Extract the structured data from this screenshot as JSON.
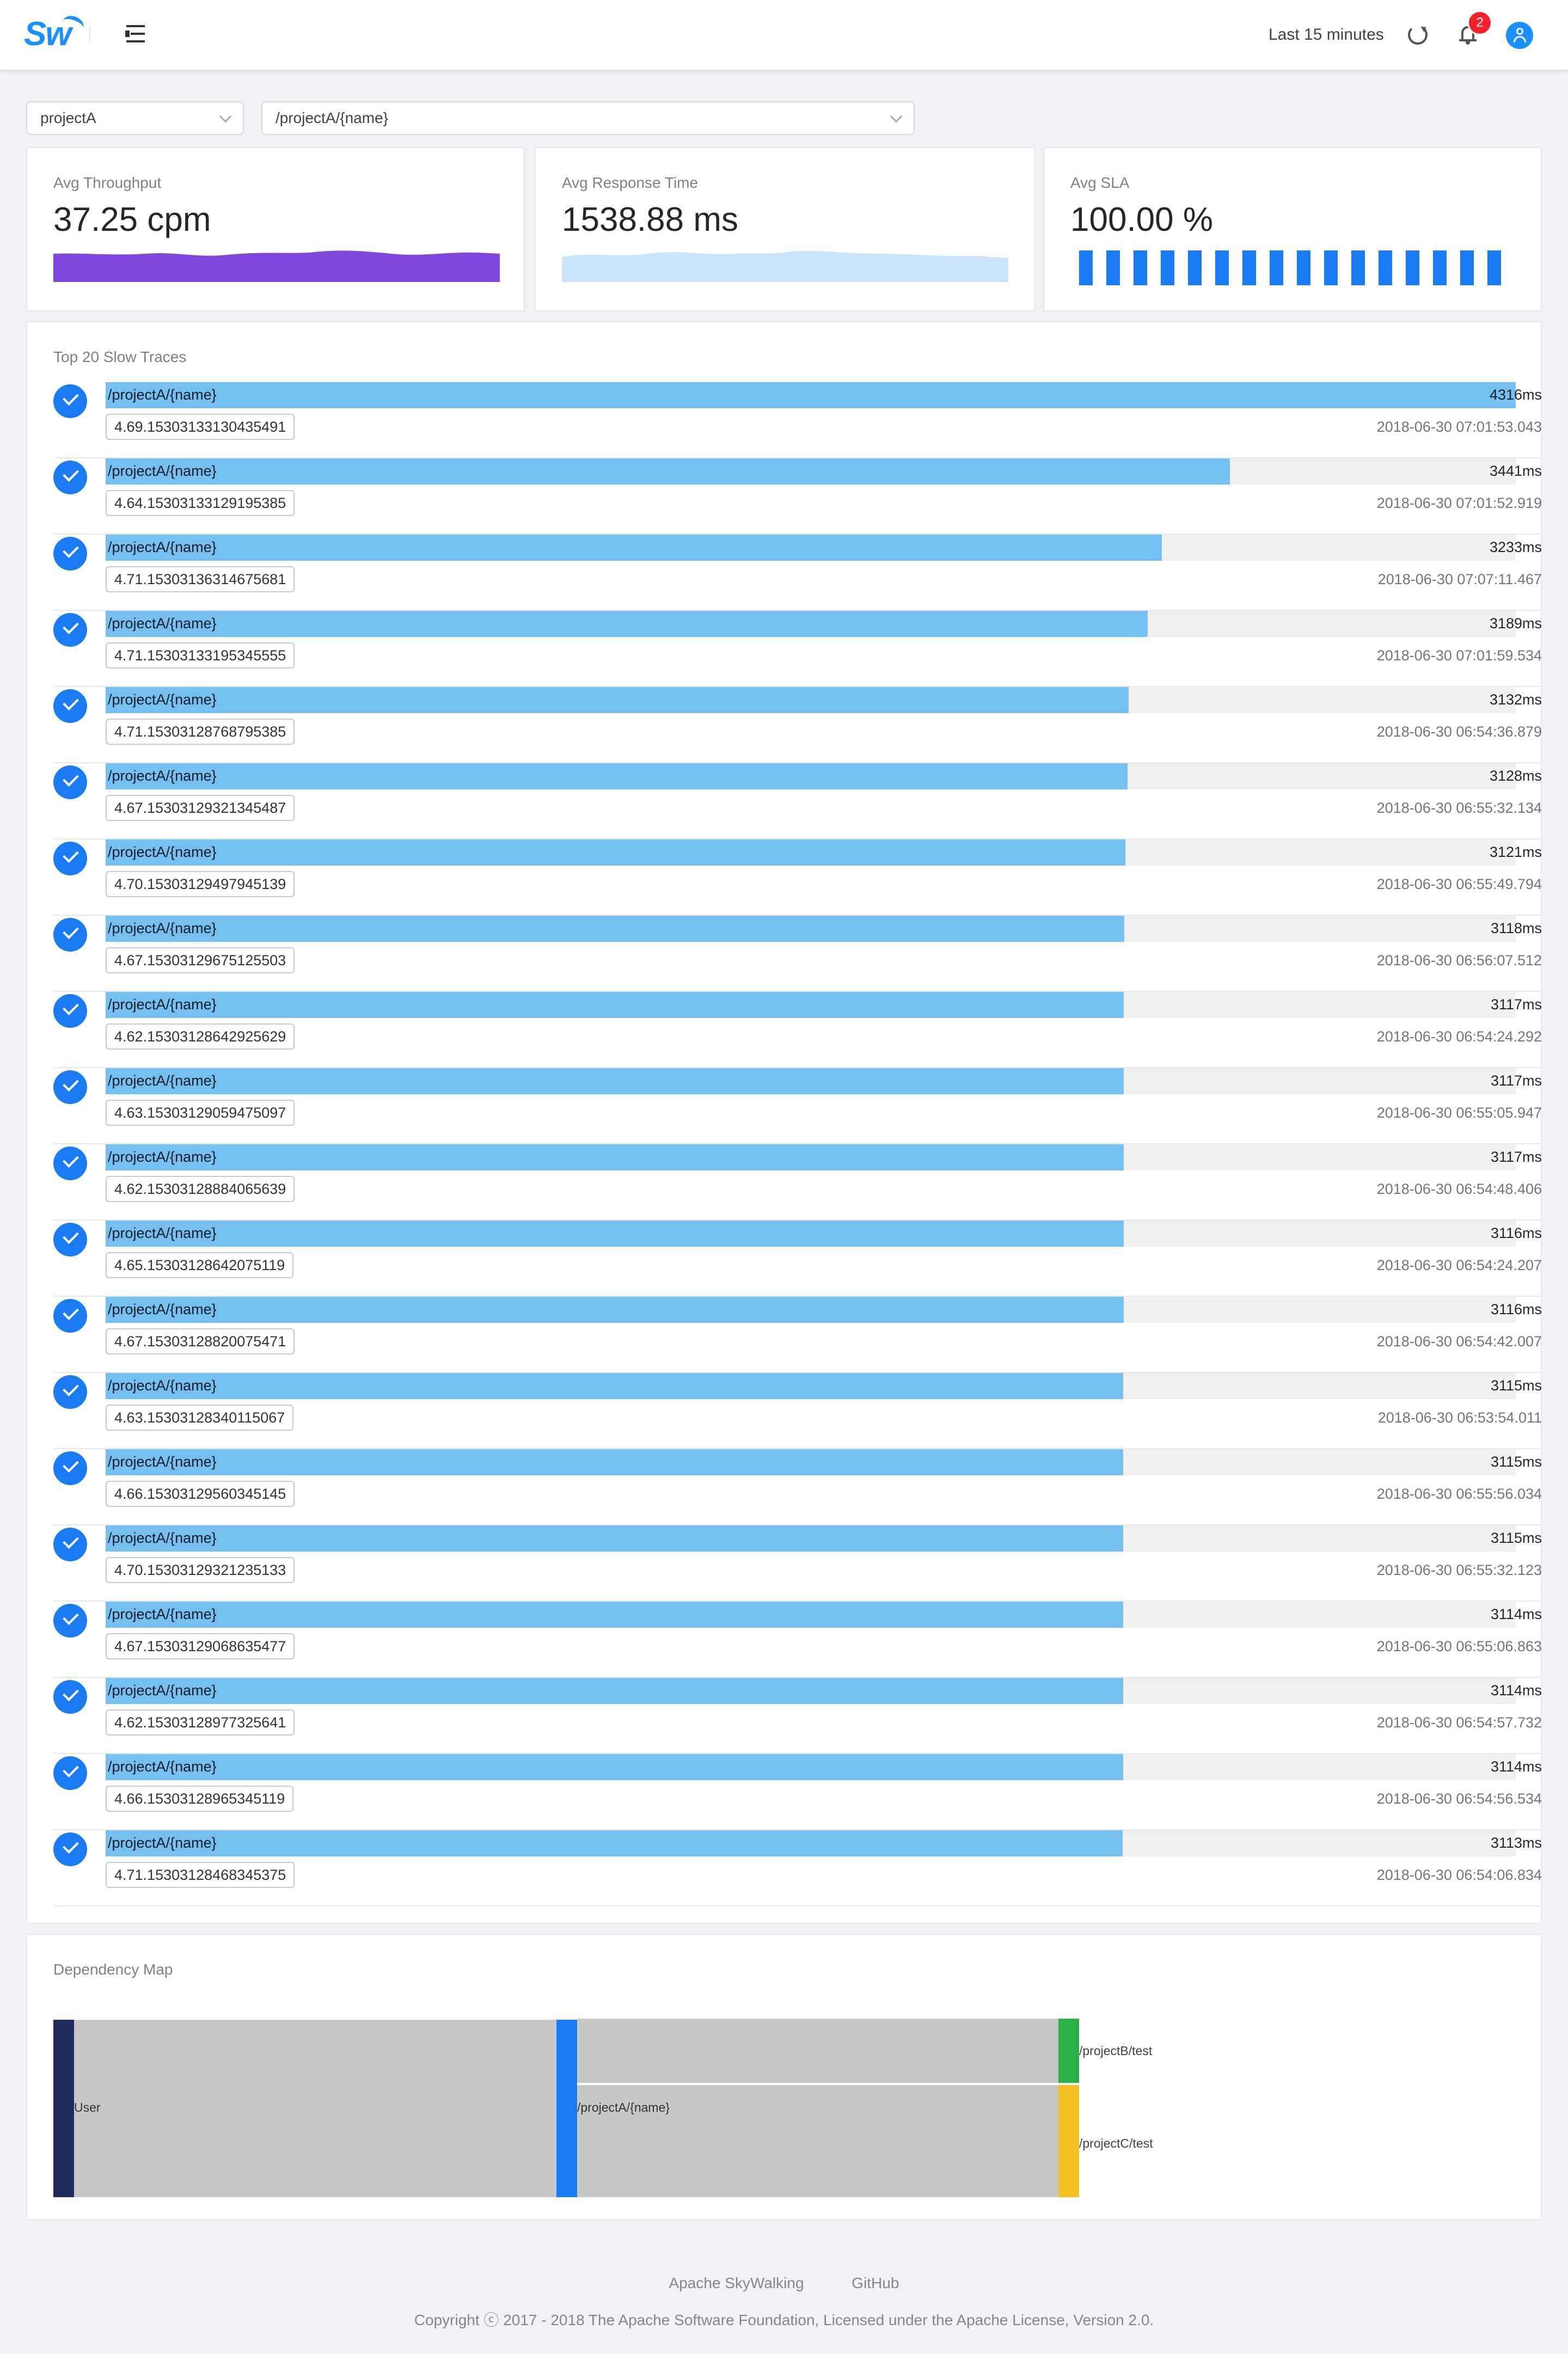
{
  "header": {
    "logo_text": "Sw",
    "time_range": "Last 15 minutes",
    "notification_count": "2"
  },
  "filters": {
    "service": "projectA",
    "endpoint": "/projectA/{name}"
  },
  "stats": {
    "throughput": {
      "title": "Avg Throughput",
      "value": "37.25",
      "unit": "cpm",
      "color": "#7f47dc"
    },
    "response_time": {
      "title": "Avg Response Time",
      "value": "1538.88",
      "unit": "ms",
      "color": "#c9e3fb"
    },
    "sla": {
      "title": "Avg SLA",
      "value": "100.00",
      "unit": "%",
      "color": "#1a7bf2",
      "bar_count": 16
    }
  },
  "slow_traces": {
    "title": "Top 20 Slow Traces",
    "max_duration": 4316,
    "items": [
      {
        "endpoint": "/projectA/{name}",
        "trace_id": "4.69.15303133130435491",
        "duration": "4316ms",
        "duration_ms": 4316,
        "time": "2018-06-30 07:01:53.043"
      },
      {
        "endpoint": "/projectA/{name}",
        "trace_id": "4.64.15303133129195385",
        "duration": "3441ms",
        "duration_ms": 3441,
        "time": "2018-06-30 07:01:52.919"
      },
      {
        "endpoint": "/projectA/{name}",
        "trace_id": "4.71.15303136314675681",
        "duration": "3233ms",
        "duration_ms": 3233,
        "time": "2018-06-30 07:07:11.467"
      },
      {
        "endpoint": "/projectA/{name}",
        "trace_id": "4.71.15303133195345555",
        "duration": "3189ms",
        "duration_ms": 3189,
        "time": "2018-06-30 07:01:59.534"
      },
      {
        "endpoint": "/projectA/{name}",
        "trace_id": "4.71.15303128768795385",
        "duration": "3132ms",
        "duration_ms": 3132,
        "time": "2018-06-30 06:54:36.879"
      },
      {
        "endpoint": "/projectA/{name}",
        "trace_id": "4.67.15303129321345487",
        "duration": "3128ms",
        "duration_ms": 3128,
        "time": "2018-06-30 06:55:32.134"
      },
      {
        "endpoint": "/projectA/{name}",
        "trace_id": "4.70.15303129497945139",
        "duration": "3121ms",
        "duration_ms": 3121,
        "time": "2018-06-30 06:55:49.794"
      },
      {
        "endpoint": "/projectA/{name}",
        "trace_id": "4.67.15303129675125503",
        "duration": "3118ms",
        "duration_ms": 3118,
        "time": "2018-06-30 06:56:07.512"
      },
      {
        "endpoint": "/projectA/{name}",
        "trace_id": "4.62.15303128642925629",
        "duration": "3117ms",
        "duration_ms": 3117,
        "time": "2018-06-30 06:54:24.292"
      },
      {
        "endpoint": "/projectA/{name}",
        "trace_id": "4.63.15303129059475097",
        "duration": "3117ms",
        "duration_ms": 3117,
        "time": "2018-06-30 06:55:05.947"
      },
      {
        "endpoint": "/projectA/{name}",
        "trace_id": "4.62.15303128884065639",
        "duration": "3117ms",
        "duration_ms": 3117,
        "time": "2018-06-30 06:54:48.406"
      },
      {
        "endpoint": "/projectA/{name}",
        "trace_id": "4.65.15303128642075119",
        "duration": "3116ms",
        "duration_ms": 3116,
        "time": "2018-06-30 06:54:24.207"
      },
      {
        "endpoint": "/projectA/{name}",
        "trace_id": "4.67.15303128820075471",
        "duration": "3116ms",
        "duration_ms": 3116,
        "time": "2018-06-30 06:54:42.007"
      },
      {
        "endpoint": "/projectA/{name}",
        "trace_id": "4.63.15303128340115067",
        "duration": "3115ms",
        "duration_ms": 3115,
        "time": "2018-06-30 06:53:54.011"
      },
      {
        "endpoint": "/projectA/{name}",
        "trace_id": "4.66.15303129560345145",
        "duration": "3115ms",
        "duration_ms": 3115,
        "time": "2018-06-30 06:55:56.034"
      },
      {
        "endpoint": "/projectA/{name}",
        "trace_id": "4.70.15303129321235133",
        "duration": "3115ms",
        "duration_ms": 3115,
        "time": "2018-06-30 06:55:32.123"
      },
      {
        "endpoint": "/projectA/{name}",
        "trace_id": "4.67.15303129068635477",
        "duration": "3114ms",
        "duration_ms": 3114,
        "time": "2018-06-30 06:55:06.863"
      },
      {
        "endpoint": "/projectA/{name}",
        "trace_id": "4.62.15303128977325641",
        "duration": "3114ms",
        "duration_ms": 3114,
        "time": "2018-06-30 06:54:57.732"
      },
      {
        "endpoint": "/projectA/{name}",
        "trace_id": "4.66.15303128965345119",
        "duration": "3114ms",
        "duration_ms": 3114,
        "time": "2018-06-30 06:54:56.534"
      },
      {
        "endpoint": "/projectA/{name}",
        "trace_id": "4.71.15303128468345375",
        "duration": "3113ms",
        "duration_ms": 3113,
        "time": "2018-06-30 06:54:06.834"
      }
    ]
  },
  "dependency_map": {
    "title": "Dependency Map",
    "nodes": [
      {
        "label": "User",
        "color": "#1e2a5a"
      },
      {
        "label": "/projectA/{name}",
        "color": "#1a7bf2"
      },
      {
        "label": "/projectB/test",
        "color": "#2db048"
      },
      {
        "label": "/projectC/test",
        "color": "#f5c025"
      }
    ]
  },
  "footer": {
    "link_skywalking": "Apache SkyWalking",
    "link_github": "GitHub",
    "copyright": "Copyright ⓒ 2017 - 2018 The Apache Software Foundation, Licensed under the Apache License, Version 2.0."
  }
}
